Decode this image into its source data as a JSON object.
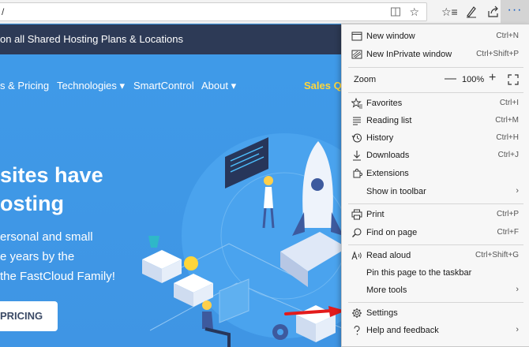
{
  "browser": {
    "url": "/",
    "more_label": "···"
  },
  "page": {
    "promo_text": "on all Shared Hosting Plans & Locations",
    "nav": [
      "s & Pricing",
      "Technologies ▾",
      "SmartControl",
      "About ▾"
    ],
    "nav_sales": "Sales Que",
    "headline": [
      "sites have",
      "osting"
    ],
    "subline": [
      "ersonal and small",
      "e years by the",
      "the FastCloud Family!"
    ],
    "cta": "PRICING"
  },
  "menu": {
    "items_top": [
      {
        "label": "New window",
        "shortcut": "Ctrl+N",
        "icon": "new-window-icon"
      },
      {
        "label": "New InPrivate window",
        "shortcut": "Ctrl+Shift+P",
        "icon": "inprivate-icon"
      }
    ],
    "zoom": {
      "label": "Zoom",
      "value": "100%",
      "minus": "—",
      "plus": "+"
    },
    "items_mid": [
      {
        "label": "Favorites",
        "shortcut": "Ctrl+I",
        "icon": "favorites-icon"
      },
      {
        "label": "Reading list",
        "shortcut": "Ctrl+M",
        "icon": "reading-list-icon"
      },
      {
        "label": "History",
        "shortcut": "Ctrl+H",
        "icon": "history-icon"
      },
      {
        "label": "Downloads",
        "shortcut": "Ctrl+J",
        "icon": "download-icon"
      },
      {
        "label": "Extensions",
        "shortcut": "",
        "icon": "extensions-icon"
      },
      {
        "label": "Show in toolbar",
        "shortcut": "",
        "icon": "",
        "submenu": true
      }
    ],
    "items_tools": [
      {
        "label": "Print",
        "shortcut": "Ctrl+P",
        "icon": "print-icon"
      },
      {
        "label": "Find on page",
        "shortcut": "Ctrl+F",
        "icon": "search-icon"
      }
    ],
    "items_read": [
      {
        "label": "Read aloud",
        "shortcut": "Ctrl+Shift+G",
        "icon": "read-aloud-icon"
      },
      {
        "label": "Pin this page to the taskbar",
        "shortcut": "",
        "icon": ""
      },
      {
        "label": "More tools",
        "shortcut": "",
        "icon": "",
        "submenu": true
      }
    ],
    "items_bottom": [
      {
        "label": "Settings",
        "shortcut": "",
        "icon": "gear-icon"
      },
      {
        "label": "Help and feedback",
        "shortcut": "",
        "icon": "help-icon",
        "submenu": true
      }
    ],
    "chevron": "›"
  },
  "colors": {
    "accent": "#0a57c2",
    "hero_blue": "#3f9ae8",
    "promo_bg": "#2d3a56",
    "sales_yellow": "#ffd63a",
    "annotation_red": "#e31b1b"
  }
}
